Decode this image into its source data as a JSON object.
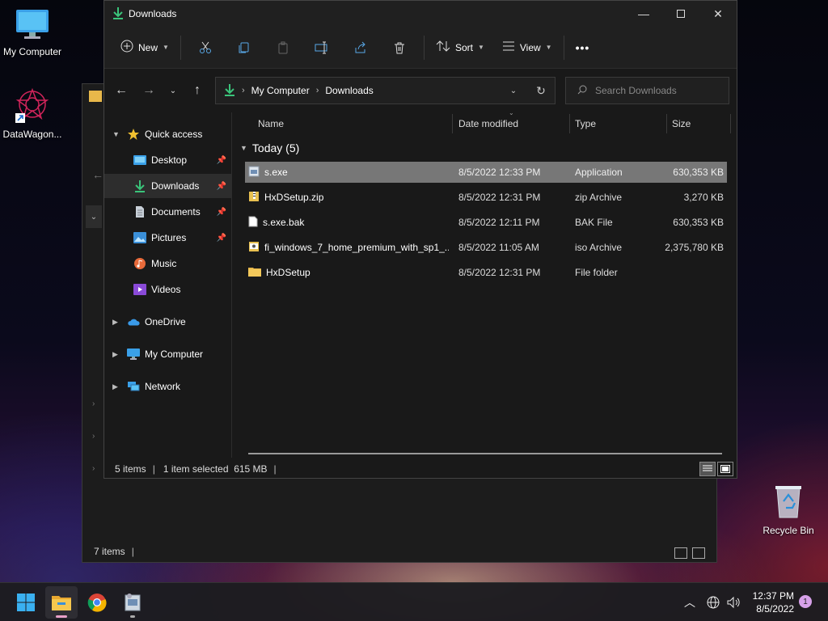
{
  "desktop": {
    "icons": [
      {
        "label": "My Computer"
      },
      {
        "label": "DataWagon..."
      },
      {
        "label": "Recycle Bin"
      }
    ]
  },
  "background_window": {
    "status": "7 items"
  },
  "window": {
    "title": "Downloads",
    "toolbar": {
      "new_label": "New",
      "sort_label": "Sort",
      "view_label": "View",
      "more_label": "•••"
    },
    "address": {
      "segments": [
        "My Computer",
        "Downloads"
      ]
    },
    "search": {
      "placeholder": "Search Downloads"
    },
    "nav": {
      "items": [
        {
          "label": "Quick access"
        },
        {
          "label": "Desktop"
        },
        {
          "label": "Downloads"
        },
        {
          "label": "Documents"
        },
        {
          "label": "Pictures"
        },
        {
          "label": "Music"
        },
        {
          "label": "Videos"
        },
        {
          "label": "OneDrive"
        },
        {
          "label": "My Computer"
        },
        {
          "label": "Network"
        }
      ]
    },
    "columns": [
      "Name",
      "Date modified",
      "Type",
      "Size"
    ],
    "group": "Today (5)",
    "files": [
      {
        "name": "s.exe",
        "date": "8/5/2022 12:33 PM",
        "type": "Application",
        "size": "630,353 KB"
      },
      {
        "name": "HxDSetup.zip",
        "date": "8/5/2022 12:31 PM",
        "type": "zip Archive",
        "size": "3,270 KB"
      },
      {
        "name": "s.exe.bak",
        "date": "8/5/2022 12:11 PM",
        "type": "BAK File",
        "size": "630,353 KB"
      },
      {
        "name": "fi_windows_7_home_premium_with_sp1_...",
        "date": "8/5/2022 11:05 AM",
        "type": "iso Archive",
        "size": "2,375,780 KB"
      },
      {
        "name": "HxDSetup",
        "date": "8/5/2022 12:31 PM",
        "type": "File folder",
        "size": ""
      }
    ],
    "status": {
      "count": "5 items",
      "selection": "1 item selected  615 MB"
    }
  },
  "taskbar": {
    "time": "12:37 PM",
    "date": "8/5/2022",
    "notifications": "1"
  }
}
